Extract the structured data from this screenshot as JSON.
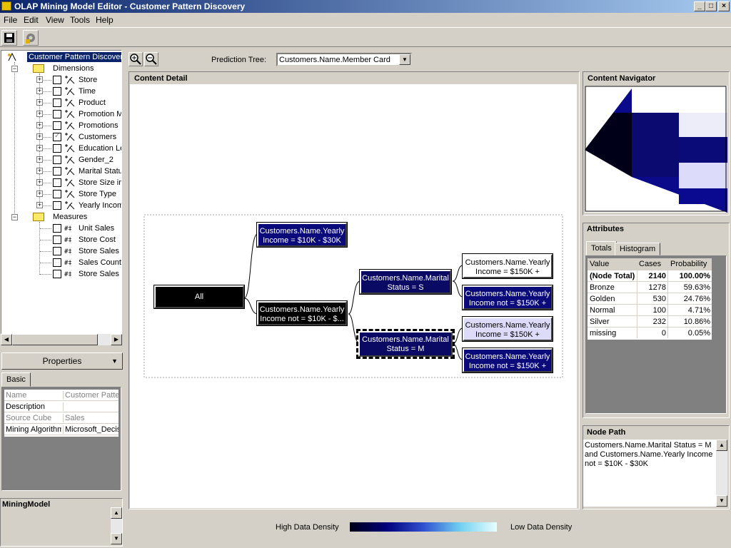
{
  "window": {
    "title": "OLAP Mining Model Editor - Customer Pattern Discovery"
  },
  "menu": {
    "file": "File",
    "edit": "Edit",
    "view": "View",
    "tools": "Tools",
    "help": "Help"
  },
  "tree": {
    "root": "Customer Pattern Discovery",
    "dimensions_label": "Dimensions",
    "dimensions": [
      "Store",
      "Time",
      "Product",
      "Promotion Media",
      "Promotions",
      "Customers",
      "Education Level",
      "Gender_2",
      "Marital Status",
      "Store Size in SQFT",
      "Store Type",
      "Yearly Income"
    ],
    "measures_label": "Measures",
    "measures": [
      "Unit Sales",
      "Store Cost",
      "Store Sales",
      "Sales Count",
      "Store Sales Net"
    ]
  },
  "properties": {
    "button": "Properties",
    "tab": "Basic",
    "rows": [
      {
        "name": "Name",
        "value": "Customer Pattern Discovery"
      },
      {
        "name": "Description",
        "value": ""
      },
      {
        "name": "Source Cube",
        "value": "Sales"
      },
      {
        "name": "Mining Algorithm",
        "value": "Microsoft_Decision_Trees"
      }
    ]
  },
  "mining_model_label": "MiningModel",
  "prediction": {
    "label": "Prediction Tree:",
    "value": "Customers.Name.Member Card"
  },
  "content_detail": {
    "title": "Content Detail",
    "nodes": {
      "all": "All",
      "n1a": "Customers.Name.Yearly",
      "n1b": "Income = $10K - $30K",
      "n2a": "Customers.Name.Yearly",
      "n2b": "Income not = $10K - $...",
      "n3a": "Customers.Name.Marital",
      "n3b": "Status = S",
      "n4a": "Customers.Name.Marital",
      "n4b": "Status = M",
      "n5a": "Customers.Name.Yearly",
      "n5b": "Income = $150K +",
      "n6a": "Customers.Name.Yearly",
      "n6b": "Income not = $150K +",
      "n7a": "Customers.Name.Yearly",
      "n7b": "Income = $150K +",
      "n8a": "Customers.Name.Yearly",
      "n8b": "Income not = $150K +"
    }
  },
  "navigator": {
    "title": "Content Navigator"
  },
  "attributes": {
    "title": "Attributes",
    "tabs": [
      "Totals",
      "Histogram"
    ],
    "headers": [
      "Value",
      "Cases",
      "Probability"
    ],
    "rows": [
      {
        "value": "(Node Total)",
        "cases": "2140",
        "prob": "100.00%"
      },
      {
        "value": "Bronze",
        "cases": "1278",
        "prob": "59.63%"
      },
      {
        "value": "Golden",
        "cases": "530",
        "prob": "24.76%"
      },
      {
        "value": "Normal",
        "cases": "100",
        "prob": "4.71%"
      },
      {
        "value": "Silver",
        "cases": "232",
        "prob": "10.86%"
      },
      {
        "value": "missing",
        "cases": "0",
        "prob": "0.05%"
      }
    ]
  },
  "node_path": {
    "title": "Node Path",
    "text": "Customers.Name.Marital Status = M and Customers.Name.Yearly Income not = $10K - $30K"
  },
  "legend": {
    "high": "High Data Density",
    "low": "Low Data Density"
  },
  "colors": {
    "node_dark": "#0a0a64",
    "node_black": "#000000",
    "node_light": "#dcdcfa",
    "title_blue": "#0a246a"
  }
}
